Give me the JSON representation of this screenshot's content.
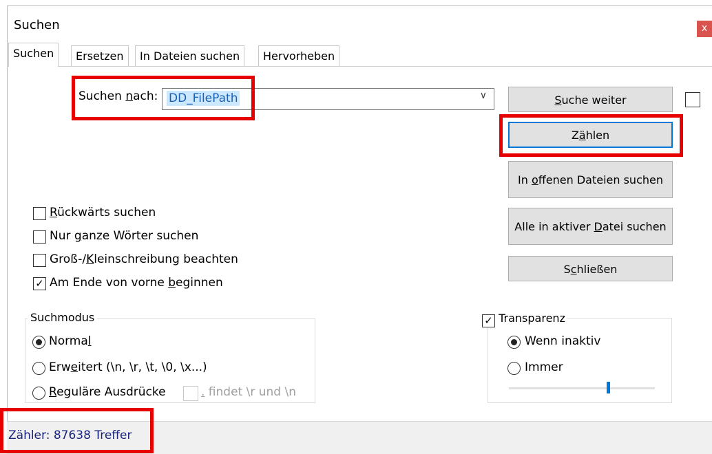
{
  "window": {
    "title": "Suchen",
    "close_label": "x"
  },
  "tabs": [
    {
      "label": "Suchen"
    },
    {
      "label": "Ersetzen"
    },
    {
      "label": "In Dateien suchen"
    },
    {
      "label": "Hervorheben"
    }
  ],
  "search": {
    "label_prefix": "Suchen ",
    "label_underlined": "n",
    "label_suffix": "ach:",
    "value": "DD_FilePath"
  },
  "buttons": {
    "find_next": {
      "u": "S",
      "rest": "uche weiter"
    },
    "count": {
      "pre": "Z",
      "u": "ä",
      "rest": "hlen"
    },
    "find_open": {
      "pre": "In ",
      "u": "o",
      "rest": "ffenen Dateien suchen"
    },
    "find_active": {
      "pre": "Alle in aktiver ",
      "u": "D",
      "rest": "atei suchen"
    },
    "close": {
      "pre": "S",
      "u": "c",
      "rest": "hließen"
    }
  },
  "options": {
    "backward": {
      "u": "R",
      "rest": "ückwärts suchen",
      "checked": false
    },
    "whole_word": {
      "pre": "Nur ",
      "u": "g",
      "rest": "anze Wörter suchen",
      "checked": false
    },
    "match_case": {
      "pre": "Groß-/",
      "u": "K",
      "rest": "leinschreibung beachten",
      "checked": false
    },
    "wrap": {
      "pre": "Am Ende von vorne ",
      "u": "b",
      "rest": "eginnen",
      "checked": true
    }
  },
  "search_mode": {
    "legend": "Suchmodus",
    "normal": {
      "pre": "Norma",
      "u": "l",
      "rest": "",
      "selected": true
    },
    "extended": {
      "pre": "Erw",
      "u": "e",
      "rest": "itert (\\n, \\r, \\t, \\0, \\x...)",
      "selected": false
    },
    "regex": {
      "u": "R",
      "rest": "eguläre Ausdrücke",
      "selected": false
    },
    "dot_matches": {
      "u": ".",
      "rest": " findet \\r und \\n",
      "checked": false
    }
  },
  "transparency": {
    "label": "Transparenz",
    "checked": true,
    "on_inactive": "Wenn inaktiv",
    "always": "Immer",
    "level": 0.68
  },
  "status": {
    "text": "Zähler: 87638 Treffer"
  },
  "colors": {
    "annotation": "#e60000",
    "status_text": "#1a237e",
    "selection": "#cce8ff"
  }
}
